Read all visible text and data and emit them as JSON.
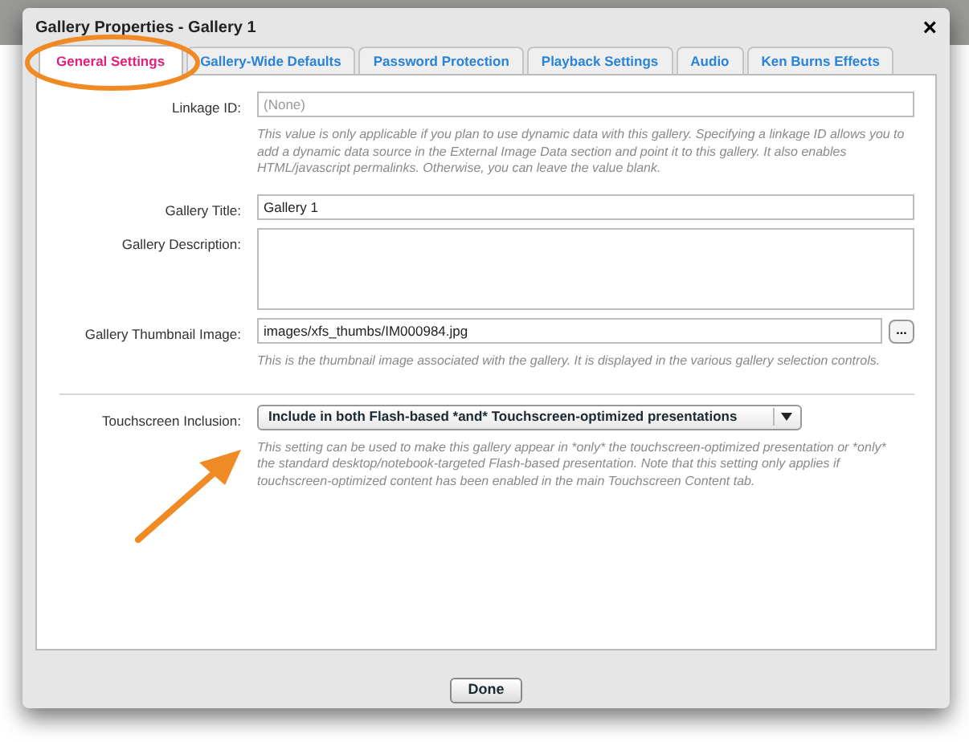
{
  "window": {
    "title": "Gallery Properties - Gallery 1",
    "close": "×"
  },
  "tabs": [
    {
      "label": "General Settings",
      "selected": true
    },
    {
      "label": "Gallery-Wide Defaults",
      "selected": false
    },
    {
      "label": "Password Protection",
      "selected": false
    },
    {
      "label": "Playback Settings",
      "selected": false
    },
    {
      "label": "Audio",
      "selected": false
    },
    {
      "label": "Ken Burns Effects",
      "selected": false
    }
  ],
  "fields": [
    {
      "kind": "text",
      "label": "Linkage ID:",
      "placeholder": "(None)",
      "help": "This value is only applicable if you plan to use dynamic data with this gallery.  Specifying a linkage ID allows you to add a dynamic data source in the External Image Data section and point it to this gallery.  It also enables HTML/javascript permalinks.  Otherwise, you can leave the value blank."
    },
    {
      "kind": "text",
      "label": "Gallery Title:",
      "value": "Gallery 1"
    },
    {
      "kind": "textarea",
      "label": "Gallery Description:"
    },
    {
      "kind": "browse",
      "label": "Gallery Thumbnail Image:",
      "value": "images/xfs_thumbs/IM000984.jpg",
      "button": "...",
      "help": "This is the thumbnail image associated with the gallery.  It is displayed in the various gallery selection controls."
    },
    {
      "kind": "select",
      "label": "Touchscreen Inclusion:",
      "value": "Include in both Flash-based *and* Touchscreen-optimized presentations",
      "help": "This setting can be used to make this gallery appear in *only* the touchscreen-optimized presentation or *only* the standard desktop/notebook-targeted Flash-based presentation.  Note that this setting only applies if touchscreen-optimized content has been enabled in the main Touchscreen Content tab."
    }
  ],
  "buttons": [
    "Done"
  ]
}
